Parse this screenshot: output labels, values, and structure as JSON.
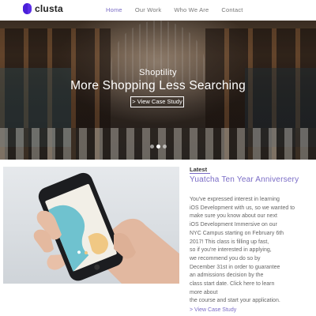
{
  "brand": {
    "name": "clusta",
    "accent": "#5b2ee8"
  },
  "nav": [
    {
      "label": "Home",
      "active": true
    },
    {
      "label": "Our Work",
      "active": false
    },
    {
      "label": "Who We Are",
      "active": false
    },
    {
      "label": "Contact",
      "active": false
    }
  ],
  "hero": {
    "eyebrow": "Shoptility",
    "title": "More Shopping Less Searching",
    "button_label": "> View Case Study",
    "slides_count": 3,
    "active_slide": 2
  },
  "feature": {
    "tag": "Latest",
    "title": "Yuatcha Ten Year Anniversery",
    "body": "You've expressed interest in learning\niOS Development with us, so we wanted to\nmake sure you know about our next\niOS Development Immersive on our\nNYC Campus starting on February 6th\n2017! This class is filling up fast,\nso if you're interested in applying,\nwe recommend you do so by\nDecember 31st in order to guarantee\nan admissions decision by the\nclass start date. Click here to learn\nmore about\nthe course and start your application.",
    "link_label": "> View Case Study"
  },
  "colors": {
    "link": "#7a6cc6"
  }
}
